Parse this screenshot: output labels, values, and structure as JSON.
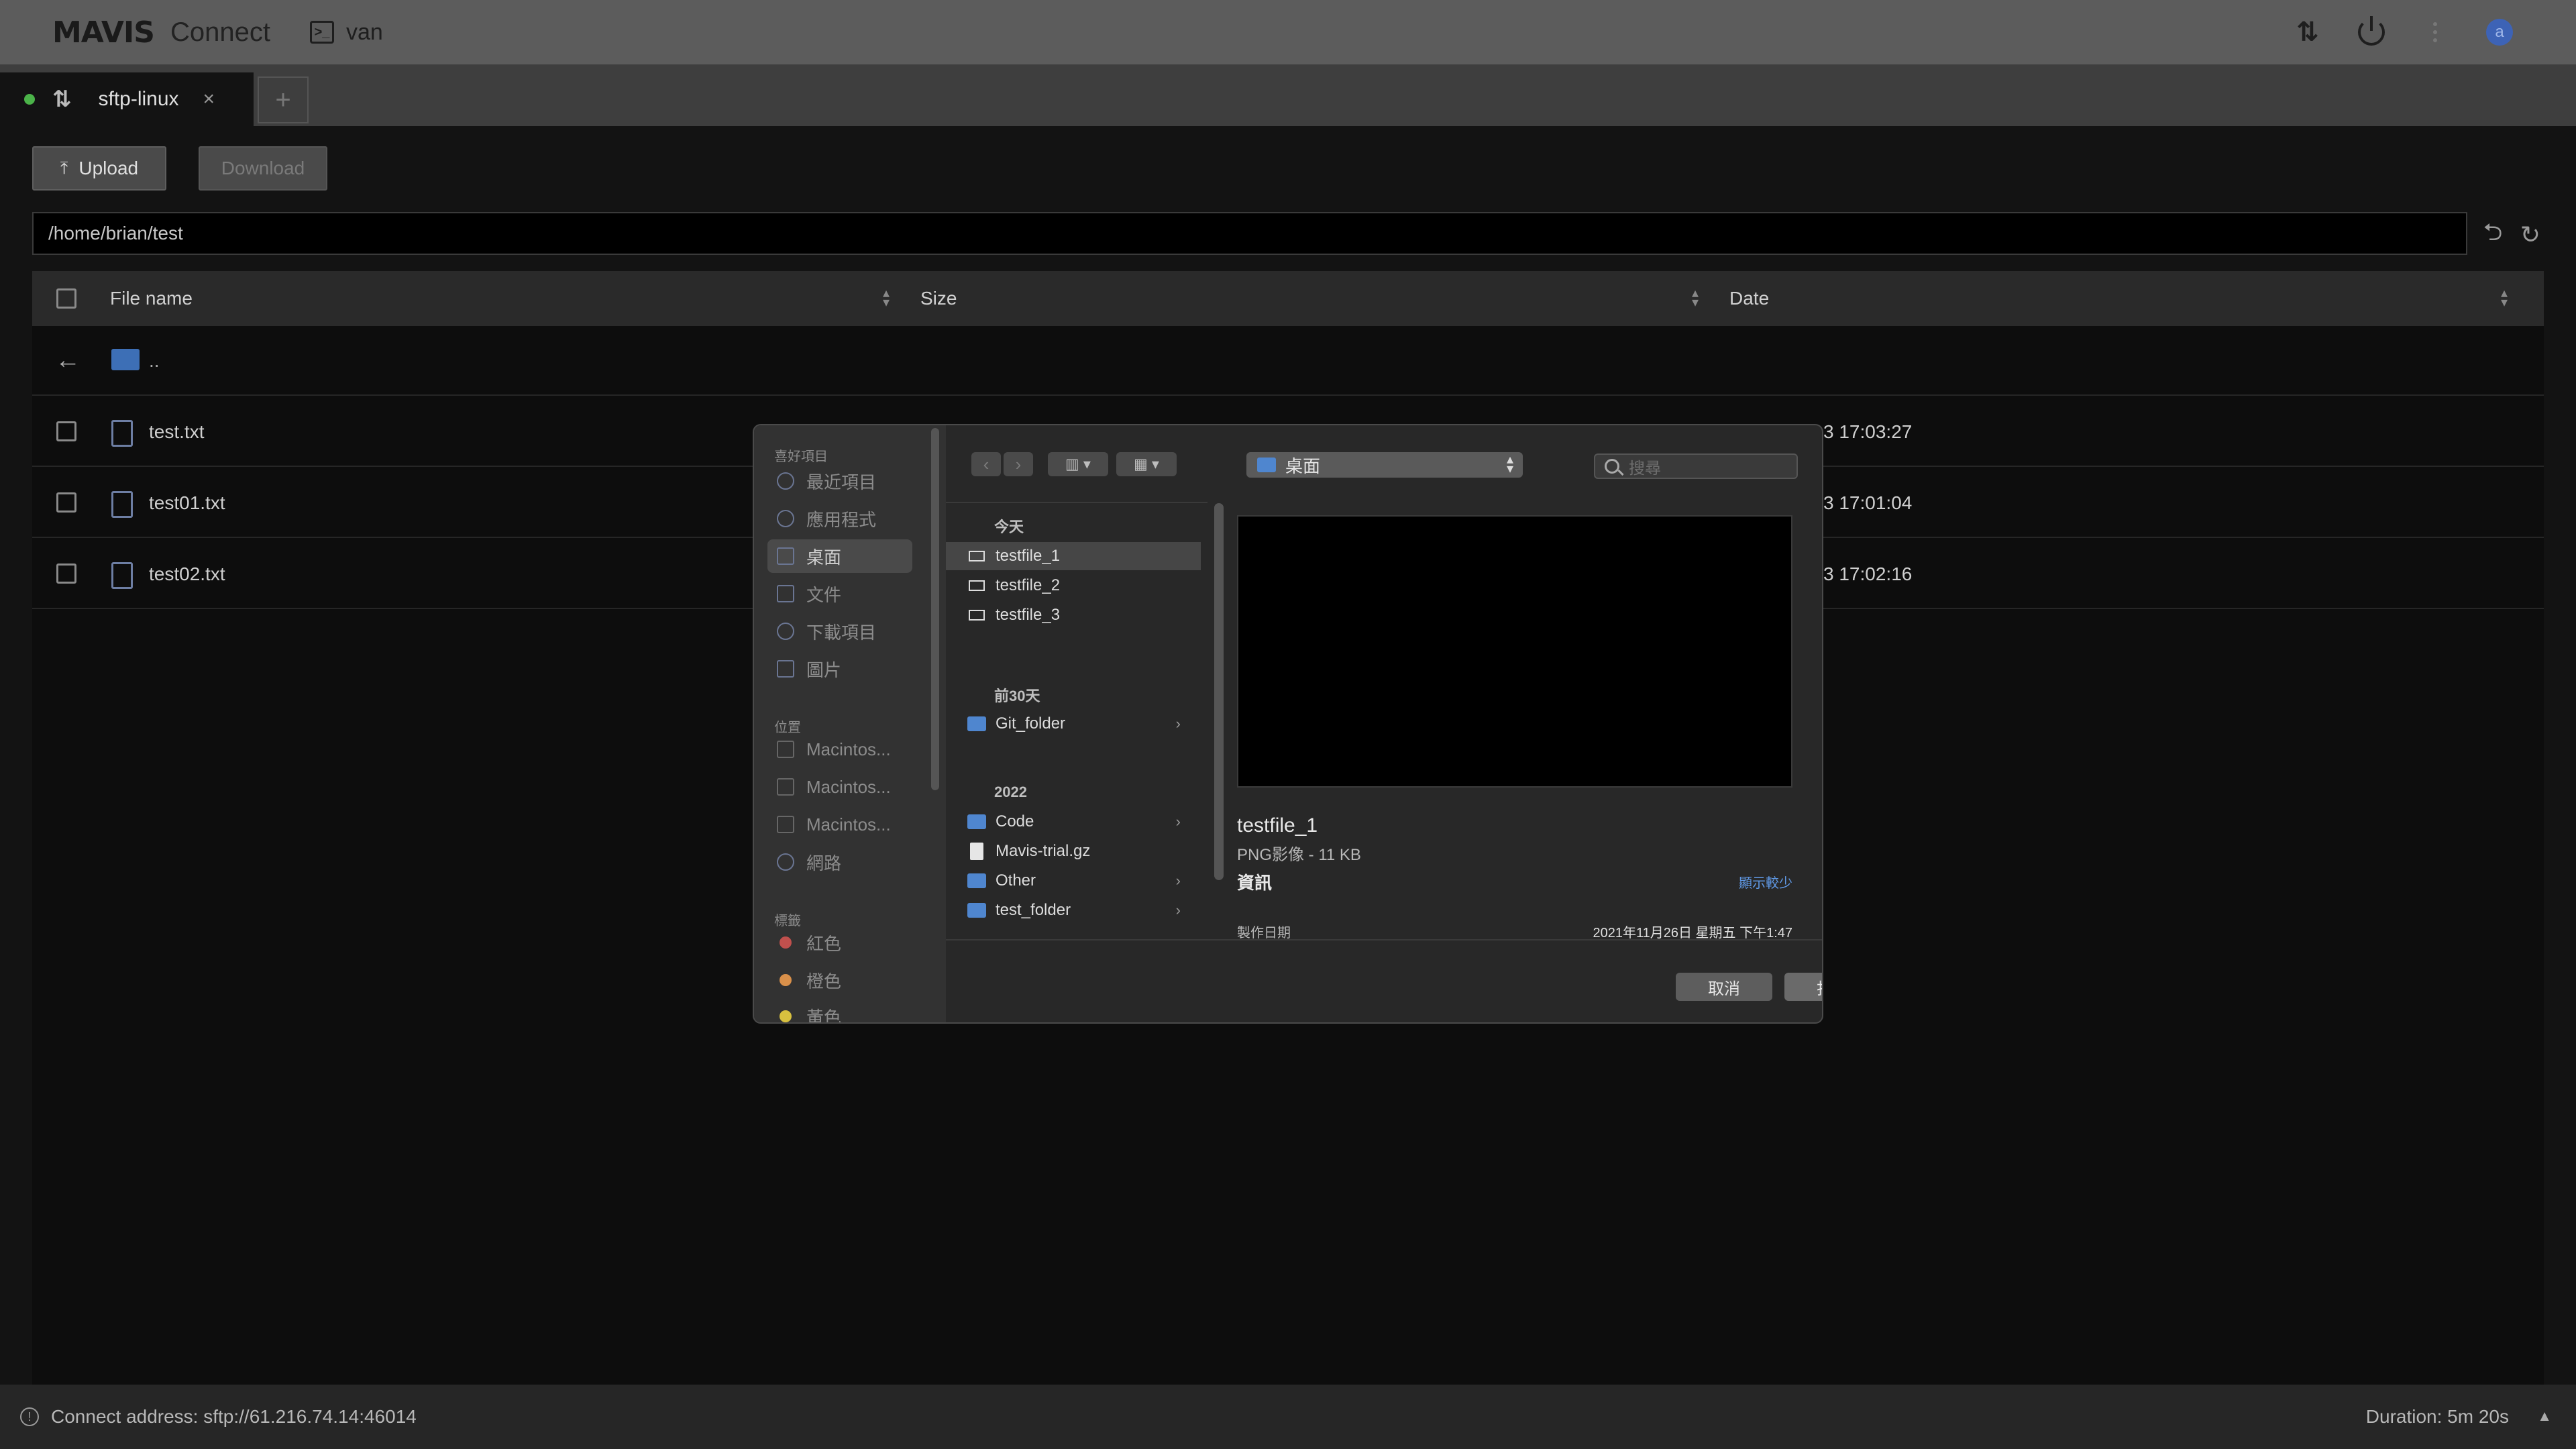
{
  "app": {
    "logo_main": "MAVIS",
    "logo_sub": "Connect",
    "connection_name": "van",
    "terminal_glyph": ">_",
    "transfer_glyph": "⇅",
    "avatar_letter": "a"
  },
  "tabs": [
    {
      "label": "sftp-linux",
      "status_color": "#4bb349",
      "close": "×"
    }
  ],
  "tab_add": "+",
  "toolbar": {
    "upload_label": "Upload",
    "download_label": "Download"
  },
  "path": {
    "value": "/home/brian/test"
  },
  "table": {
    "columns": {
      "name": "File name",
      "size": "Size",
      "date": "Date"
    },
    "parent_label": "..",
    "rows": [
      {
        "name": "test.txt",
        "date_visible": "3 17:03:27"
      },
      {
        "name": "test01.txt",
        "date_visible": "3 17:01:04"
      },
      {
        "name": "test02.txt",
        "date_visible": "3 17:02:16"
      }
    ]
  },
  "status": {
    "connect_address": "Connect address: sftp://61.216.74.14:46014",
    "duration": "Duration: 5m 20s",
    "info_glyph": "!"
  },
  "dialog": {
    "sidebar": {
      "favorites_header": "喜好項目",
      "favorites": [
        "最近項目",
        "應用程式",
        "桌面",
        "文件",
        "下載項目",
        "圖片"
      ],
      "locations_header": "位置",
      "locations": [
        "Macintos...",
        "Macintos...",
        "Macintos...",
        "網路"
      ],
      "tags_header": "標籤",
      "tags": [
        {
          "label": "紅色",
          "color": "#c0504d"
        },
        {
          "label": "橙色",
          "color": "#d9904a"
        },
        {
          "label": "黃色",
          "color": "#d8c13f"
        }
      ]
    },
    "location": "桌面",
    "search_placeholder": "搜尋",
    "groups": {
      "today": "今天",
      "last30": "前30天",
      "year": "2022"
    },
    "today_files": [
      "testfile_1",
      "testfile_2",
      "testfile_3"
    ],
    "last30_files": [
      "Git_folder"
    ],
    "year_files": [
      {
        "name": "Code",
        "kind": "folder"
      },
      {
        "name": "Mavis-trial.gz",
        "kind": "archive"
      },
      {
        "name": "Other",
        "kind": "folder"
      },
      {
        "name": "test_folder",
        "kind": "folder"
      }
    ],
    "preview": {
      "name": "testfile_1",
      "type": "PNG影像 - 11 KB",
      "info_header": "資訊",
      "show_less": "顯示較少",
      "created_label": "製作日期",
      "created_value": "2021年11月26日 星期五 下午1:47"
    },
    "cancel_label": "取消",
    "open_label": "打開"
  }
}
